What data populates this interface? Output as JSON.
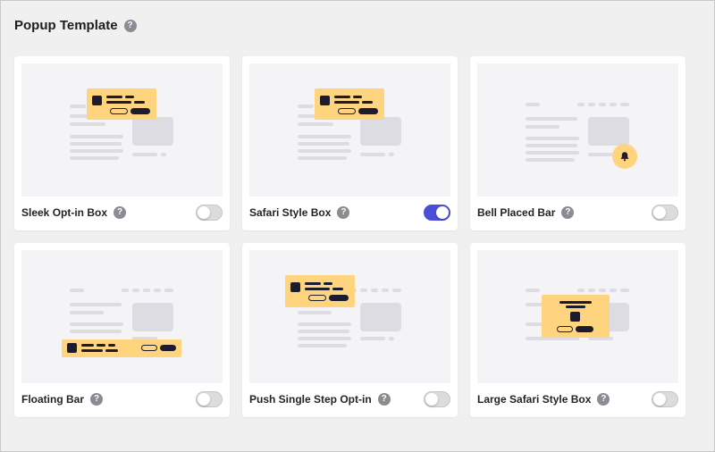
{
  "page": {
    "title": "Popup Template",
    "help_glyph": "?"
  },
  "templates": [
    {
      "label": "Sleek Opt-in Box",
      "enabled": false
    },
    {
      "label": "Safari Style Box",
      "enabled": true
    },
    {
      "label": "Bell Placed Bar",
      "enabled": false
    },
    {
      "label": "Floating Bar",
      "enabled": false
    },
    {
      "label": "Push Single Step Opt-in",
      "enabled": false
    },
    {
      "label": "Large Safari Style Box",
      "enabled": false
    }
  ],
  "colors": {
    "toggle_on": "#4a4fd6",
    "toggle_off": "#dcdcde",
    "popup_accent": "#ffd47f",
    "ink": "#1c1c2e"
  },
  "icons": {
    "help": "question-circle-icon",
    "bell": "bell-icon"
  }
}
